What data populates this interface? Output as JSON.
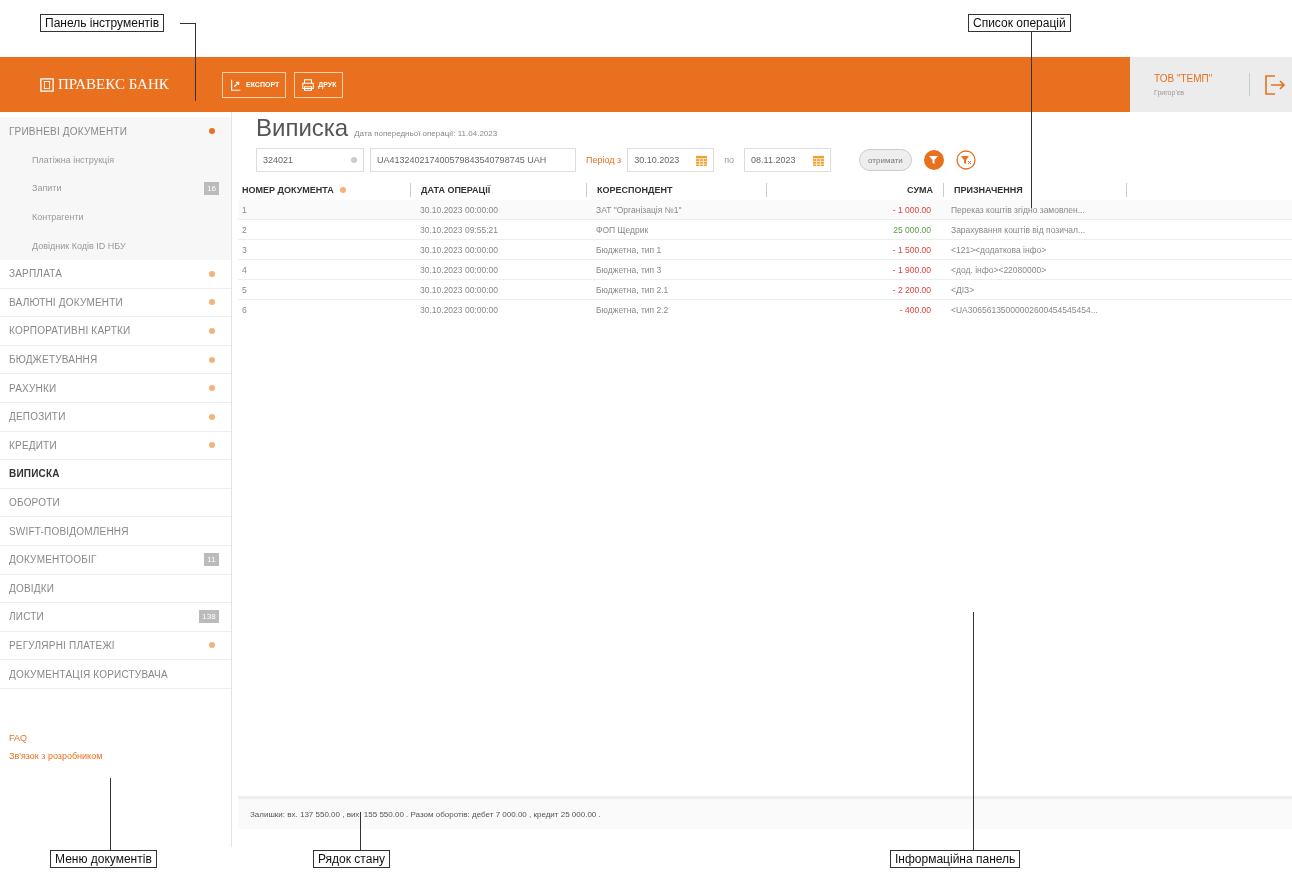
{
  "annotations": [
    {
      "label": "Панель інструментів"
    },
    {
      "label": "Список операцій"
    },
    {
      "label": "Меню документів"
    },
    {
      "label": "Рядок стану"
    },
    {
      "label": "Інформаційна панель"
    }
  ],
  "header": {
    "logo": "ПРАВЕКС БАНК",
    "buttons": [
      {
        "label": "ЕКСПОРТ",
        "kind": "export"
      },
      {
        "label": "ДРУК",
        "kind": "print"
      }
    ],
    "company": "ТОВ \"ТЕМП\"",
    "user": "Григор'єв"
  },
  "sidebar": {
    "items": [
      {
        "label": "ГРИВНЕВІ ДОКУМЕНТИ",
        "kind": "section",
        "selected": false,
        "expanded": true,
        "children": [
          {
            "label": "Платіжна інструкція"
          },
          {
            "label": "Запити",
            "badge": "16"
          },
          {
            "label": "Контрагенти"
          },
          {
            "label": "Довідник Кодів ID НБУ"
          }
        ]
      },
      {
        "label": "ЗАРПЛАТА",
        "kind": "section",
        "selected": false,
        "expanded": false
      },
      {
        "label": "ВАЛЮТНІ ДОКУМЕНТИ",
        "kind": "section",
        "selected": false,
        "expanded": false
      },
      {
        "label": "КОРПОРАТИВНІ КАРТКИ",
        "kind": "section",
        "selected": false,
        "expanded": false
      },
      {
        "label": "БЮДЖЕТУВАННЯ",
        "kind": "section",
        "selected": false,
        "expanded": false
      },
      {
        "label": "РАХУНКИ",
        "kind": "section",
        "selected": false,
        "expanded": false
      },
      {
        "label": "ДЕПОЗИТИ",
        "kind": "section",
        "selected": false,
        "expanded": false
      },
      {
        "label": "КРЕДИТИ",
        "kind": "section",
        "selected": false,
        "expanded": false
      },
      {
        "label": "ВИПИСКА",
        "kind": "link",
        "selected": true
      },
      {
        "label": "ОБОРОТИ",
        "kind": "link",
        "selected": false
      },
      {
        "label": "SWIFT-ПОВІДОМЛЕННЯ",
        "kind": "link",
        "selected": false
      },
      {
        "label": "ДОКУМЕНТООБІГ",
        "kind": "link",
        "selected": false,
        "badge": "11"
      },
      {
        "label": "ДОВІДКИ",
        "kind": "link",
        "selected": false
      },
      {
        "label": "ЛИСТИ",
        "kind": "link",
        "selected": false,
        "badge": "138"
      },
      {
        "label": "РЕГУЛЯРНІ ПЛАТЕЖІ",
        "kind": "section",
        "selected": false,
        "expanded": false
      },
      {
        "label": "ДОКУМЕНТАЦІЯ КОРИСТУВАЧА",
        "kind": "link",
        "selected": false
      }
    ],
    "links": [
      "FAQ",
      "Зв'язок з розробником"
    ]
  },
  "page": {
    "title": "Виписка",
    "subtitle": "Дата попередньої операції: 11.04.2023"
  },
  "filters": {
    "account": "324021",
    "iban": "UA413240217400579843540798745 UAH",
    "period_label": "Період з",
    "date_from": "30.10.2023",
    "to_label": "по",
    "date_to": "08.11.2023",
    "get_button": "отримати"
  },
  "table": {
    "columns": [
      {
        "label": "НОМЕР ДОКУМЕНТА",
        "sorted": true
      },
      {
        "label": "ДАТА ОПЕРАЦІЇ",
        "sorted": false
      },
      {
        "label": "КОРЕСПОНДЕНТ",
        "sorted": false
      },
      {
        "label": "СУМА",
        "sorted": false
      },
      {
        "label": "ПРИЗНАЧЕННЯ",
        "sorted": false
      }
    ],
    "rows": [
      {
        "number": "1",
        "date": "30.10.2023 00:00:00",
        "counterparty": "ЗАТ \"Організація №1\"",
        "amount": "- 1 000.00",
        "kind": "debit",
        "purpose": "Переказ коштів згідно замовлен..."
      },
      {
        "number": "2",
        "date": "30.10.2023 09:55:21",
        "counterparty": "ФОП Щедрик",
        "amount": "25 000.00",
        "kind": "credit",
        "purpose": "Зарахування коштів від позичал..."
      },
      {
        "number": "3",
        "date": "30.10.2023 00:00:00",
        "counterparty": "Бюджетна, тип 1",
        "amount": "- 1 500.00",
        "kind": "debit",
        "purpose": "<121><додаткова інфо>"
      },
      {
        "number": "4",
        "date": "30.10.2023 00:00:00",
        "counterparty": "Бюджетна, тип 3",
        "amount": "- 1 900.00",
        "kind": "debit",
        "purpose": "<дод. інфо><22080000>"
      },
      {
        "number": "5",
        "date": "30.10.2023 00:00:00",
        "counterparty": "Бюджетна, тип 2.1",
        "amount": "- 2 200.00",
        "kind": "debit",
        "purpose": "<ДІЗ>"
      },
      {
        "number": "6",
        "date": "30.10.2023 00:00:00",
        "counterparty": "Бюджетна, тип 2.2",
        "amount": "- 400.00",
        "kind": "debit",
        "purpose": "<UA30656135000002600454545454..."
      }
    ]
  },
  "status_bar": "Залишки: вх. 137 550.00 , вих. 155 550.00 . Разом оборотів: дебет 7 000.00 , кредит 25 000.00 ."
}
